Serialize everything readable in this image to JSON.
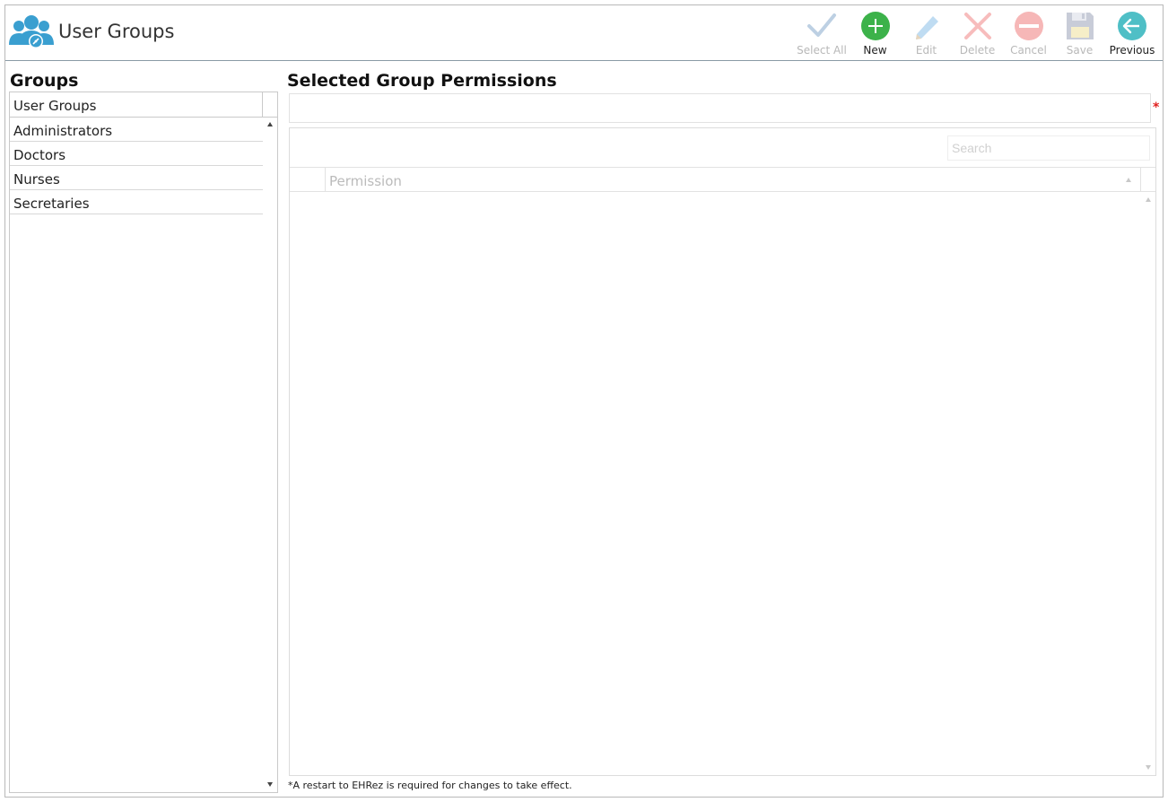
{
  "header": {
    "title": "User Groups",
    "app_icon": "user-groups-icon",
    "toolbar": [
      {
        "id": "select_all",
        "label": "Select All",
        "icon": "checkmark-icon",
        "enabled": false
      },
      {
        "id": "new",
        "label": "New",
        "icon": "plus-circle-icon",
        "enabled": true
      },
      {
        "id": "edit",
        "label": "Edit",
        "icon": "pencil-icon",
        "enabled": false
      },
      {
        "id": "delete",
        "label": "Delete",
        "icon": "x-icon",
        "enabled": false
      },
      {
        "id": "cancel",
        "label": "Cancel",
        "icon": "minus-circle-icon",
        "enabled": false
      },
      {
        "id": "save",
        "label": "Save",
        "icon": "floppy-disk-icon",
        "enabled": false
      },
      {
        "id": "previous",
        "label": "Previous",
        "icon": "arrow-left-circle-icon",
        "enabled": true
      }
    ]
  },
  "groups": {
    "title": "Groups",
    "column_header": "User Groups",
    "items": [
      "Administrators",
      "Doctors",
      "Nurses",
      "Secretaries"
    ]
  },
  "permissions": {
    "title": "Selected Group Permissions",
    "group_name_value": "",
    "required_marker": "*",
    "search_placeholder": "Search",
    "column_header": "Permission"
  },
  "footnote": "*A restart to EHRez is required for changes to take effect.",
  "colors": {
    "new_green": "#3cb24a",
    "previous_teal": "#4fbfc6",
    "brand_blue": "#3a9fd0",
    "disabled_check": "#bdd0e3",
    "disabled_pencil": "#bfdcf2",
    "disabled_delete": "#f7bcbc",
    "disabled_cancel": "#f6b7b7",
    "disabled_save": "#c8ccd8",
    "required_red": "#e0201e"
  }
}
